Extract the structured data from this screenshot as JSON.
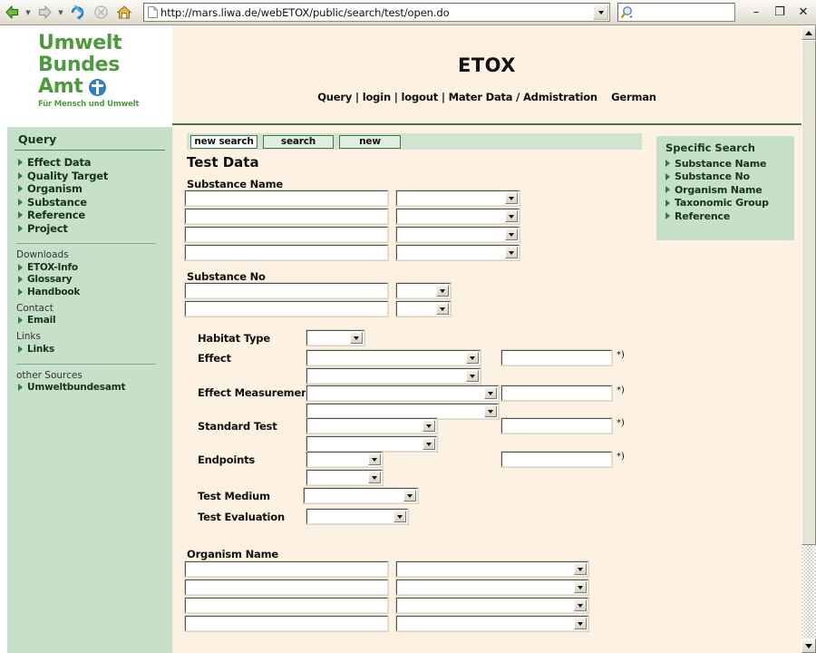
{
  "browser": {
    "back_icon": "back-arrow-icon",
    "forward_icon": "forward-arrow-icon",
    "refresh_icon": "refresh-icon",
    "stop_icon": "stop-icon",
    "home_icon": "home-icon",
    "address_value": "http://mars.liwa.de/webETOX/public/search/test/open.do",
    "address_placeholder": "",
    "search_value": "",
    "search_placeholder": "",
    "search_icon": "magnifier-icon",
    "minimize_label": "–",
    "restore_label": "❐",
    "close_label": "✕"
  },
  "logo": {
    "line1": "Umwelt",
    "line2": "Bundes",
    "line3": "Amt",
    "tagline": "Für Mensch und Umwelt",
    "emblem": "un-globe-icon"
  },
  "sidebar": {
    "title": "Query",
    "items": [
      {
        "label": "Effect Data"
      },
      {
        "label": "Quality Target"
      },
      {
        "label": "Organism"
      },
      {
        "label": "Substance"
      },
      {
        "label": "Reference"
      },
      {
        "label": "Project"
      }
    ],
    "groups": [
      {
        "label": "Downloads",
        "items": [
          {
            "label": "ETOX-Info"
          },
          {
            "label": "Glossary"
          },
          {
            "label": "Handbook"
          }
        ]
      },
      {
        "label": "Contact",
        "items": [
          {
            "label": "Email"
          }
        ]
      },
      {
        "label": "Links",
        "items": [
          {
            "label": "Links"
          }
        ]
      }
    ],
    "other_sources": {
      "label": "other Sources",
      "items": [
        {
          "label": "Umweltbundesamt"
        }
      ]
    }
  },
  "header": {
    "title": "ETOX",
    "nav": "Query | login | logout | Mater Data / Admistration    German"
  },
  "toolbar": {
    "new_search_label": "new search",
    "search_label": "search",
    "new_label": "new"
  },
  "main": {
    "page_title": "Test Data",
    "substance_name": {
      "label": "Substance Name",
      "rows": [
        {
          "text": "",
          "select": ""
        },
        {
          "text": "",
          "select": ""
        },
        {
          "text": "",
          "select": ""
        },
        {
          "text": "",
          "select": ""
        }
      ]
    },
    "substance_no": {
      "label": "Substance No",
      "rows": [
        {
          "text": "",
          "select": ""
        },
        {
          "text": "",
          "select": ""
        }
      ]
    },
    "fields": [
      {
        "label": "Habitat Type",
        "select1": "",
        "select2": null,
        "text": null,
        "note": ""
      },
      {
        "label": "Effect",
        "select1": "",
        "select2": "",
        "text": "",
        "note": "*)"
      },
      {
        "label": "Effect Measurement",
        "select1": "",
        "select2": "",
        "text": "",
        "note": "*)"
      },
      {
        "label": "Standard Test",
        "select1": "",
        "select2": "",
        "text": "",
        "note": "*)"
      },
      {
        "label": "Endpoints",
        "select1": "",
        "select2": "",
        "text": "",
        "note": "*)"
      },
      {
        "label": "Test Medium",
        "select1": "",
        "select2": null,
        "text": null,
        "note": ""
      },
      {
        "label": "Test Evaluation",
        "select1": "",
        "select2": null,
        "text": null,
        "note": ""
      }
    ],
    "organism_name": {
      "label": "Organism Name",
      "rows": [
        {
          "text": "",
          "select": ""
        },
        {
          "text": "",
          "select": ""
        },
        {
          "text": "",
          "select": ""
        },
        {
          "text": "",
          "select": ""
        }
      ]
    }
  },
  "specific_search": {
    "title": "Specific Search",
    "items": [
      {
        "label": "Substance Name"
      },
      {
        "label": "Substance No"
      },
      {
        "label": "Organism Name"
      },
      {
        "label": "Taxonomic Group"
      },
      {
        "label": "Reference"
      }
    ]
  },
  "colors": {
    "sidebar_green": "#c7e0c9",
    "content_cream": "#fdf2e2",
    "rule_green": "#3f7a46",
    "logo_green": "#4e9a3e",
    "button_bar": "#cfe4d1"
  }
}
